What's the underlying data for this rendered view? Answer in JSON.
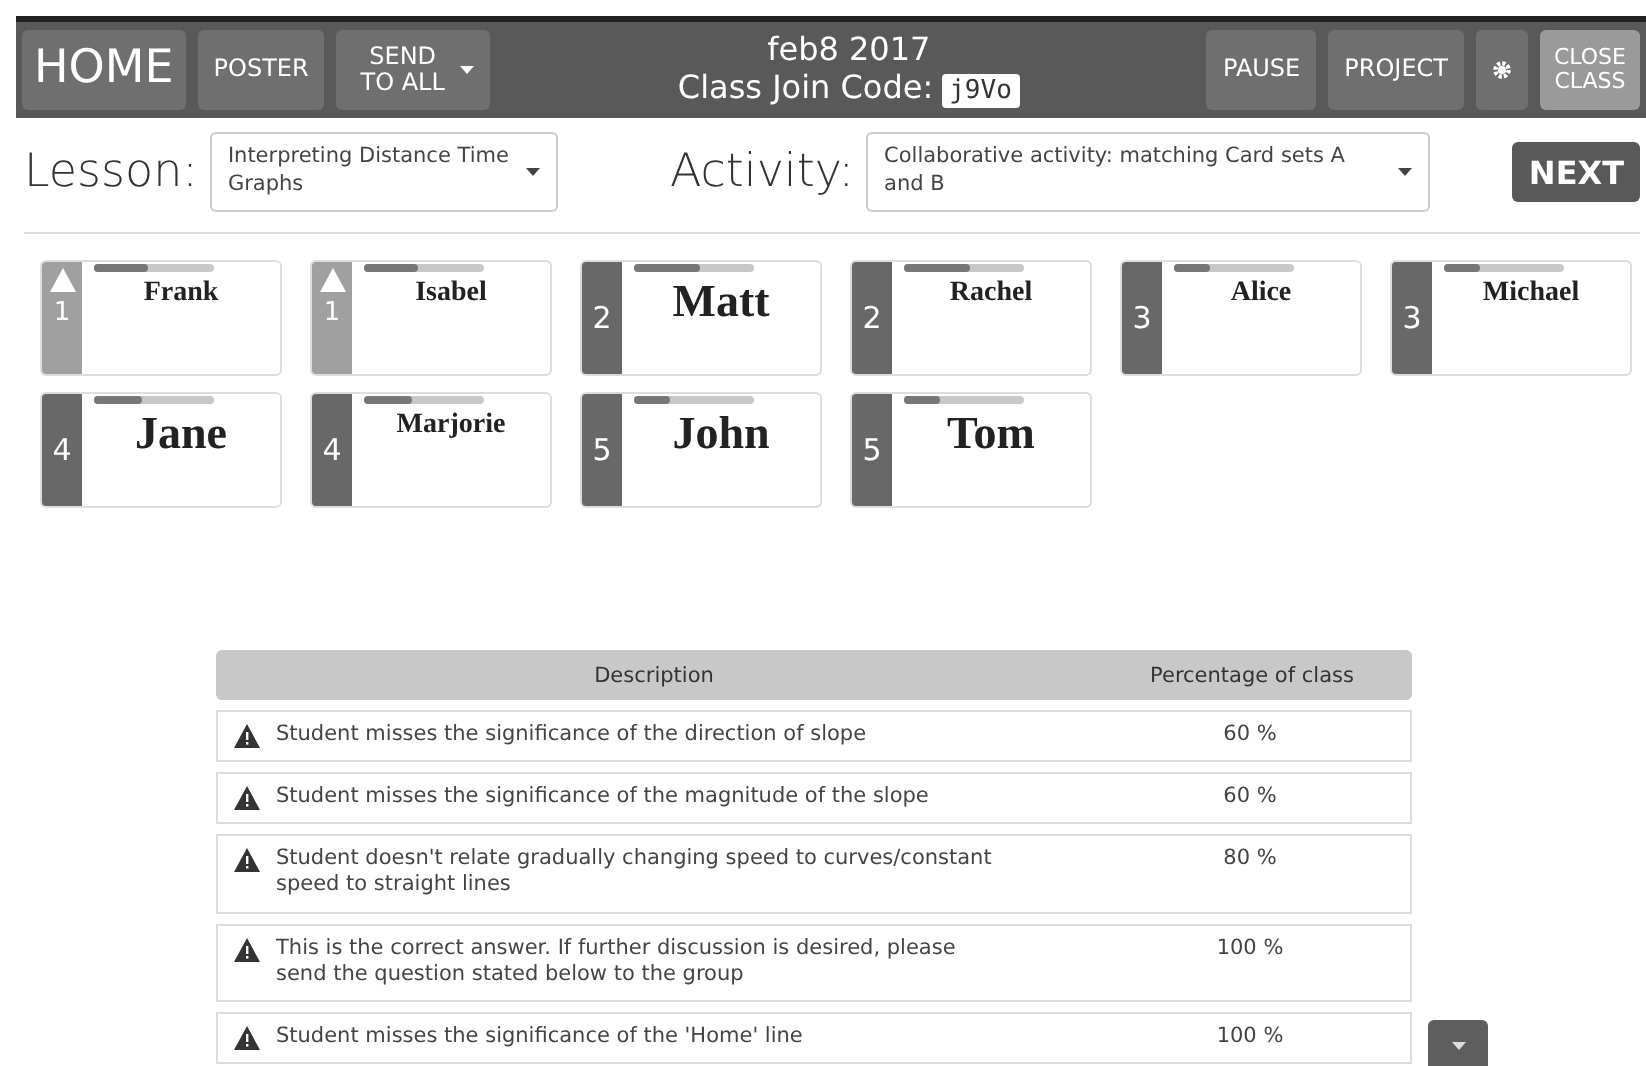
{
  "header": {
    "home": "HOME",
    "buttons": [
      {
        "label": "POSTER",
        "dropdown": false
      },
      {
        "label": "SEND TO ALL",
        "dropdown": true
      }
    ],
    "title": "feb8 2017",
    "join_label": "Class Join Code:",
    "join_code": "j9Vo",
    "right_buttons": [
      {
        "kind": "text",
        "label": "PAUSE"
      },
      {
        "kind": "text",
        "label": "PROJECT"
      },
      {
        "kind": "gear"
      },
      {
        "kind": "light",
        "label": "CLOSE CLASS"
      }
    ]
  },
  "lesson": {
    "label": "Lesson:",
    "value": "Interpreting Distance Time Graphs"
  },
  "activity": {
    "label": "Activity:",
    "value": "Collaborative activity: matching Card sets A and B"
  },
  "next": "NEXT",
  "students": [
    {
      "group": "1",
      "name": "Frank",
      "alert": true,
      "kind": "small",
      "level": 0.45
    },
    {
      "group": "1",
      "name": "Isabel",
      "alert": true,
      "kind": "small",
      "level": 0.45
    },
    {
      "group": "2",
      "name": "Matt",
      "alert": false,
      "kind": "large",
      "level": 0.55
    },
    {
      "group": "2",
      "name": "Rachel",
      "alert": false,
      "kind": "small",
      "level": 0.55
    },
    {
      "group": "3",
      "name": "Alice",
      "alert": false,
      "kind": "small",
      "level": 0.3
    },
    {
      "group": "3",
      "name": "Michael",
      "alert": false,
      "kind": "small",
      "level": 0.3
    },
    {
      "group": "4",
      "name": "Jane",
      "alert": false,
      "kind": "large",
      "level": 0.4
    },
    {
      "group": "4",
      "name": "Marjorie",
      "alert": false,
      "kind": "small",
      "level": 0.4
    },
    {
      "group": "5",
      "name": "John",
      "alert": false,
      "kind": "large",
      "level": 0.3
    },
    {
      "group": "5",
      "name": "Tom",
      "alert": false,
      "kind": "large",
      "level": 0.3
    }
  ],
  "table": {
    "columns": [
      "Description",
      "Percentage of class"
    ],
    "rows": [
      {
        "description": "Student misses the significance of the direction of slope",
        "percentage": "60 %"
      },
      {
        "description": "Student misses the significance of the magnitude of the slope",
        "percentage": "60 %"
      },
      {
        "description": "Student doesn't relate gradually changing speed to curves/constant speed to straight lines",
        "percentage": "80 %"
      },
      {
        "description": "This is the correct answer. If further discussion is desired, please send the question stated below to the group",
        "percentage": "100 %"
      },
      {
        "description": "Student misses the significance of the 'Home' line",
        "percentage": "100 %"
      }
    ]
  }
}
